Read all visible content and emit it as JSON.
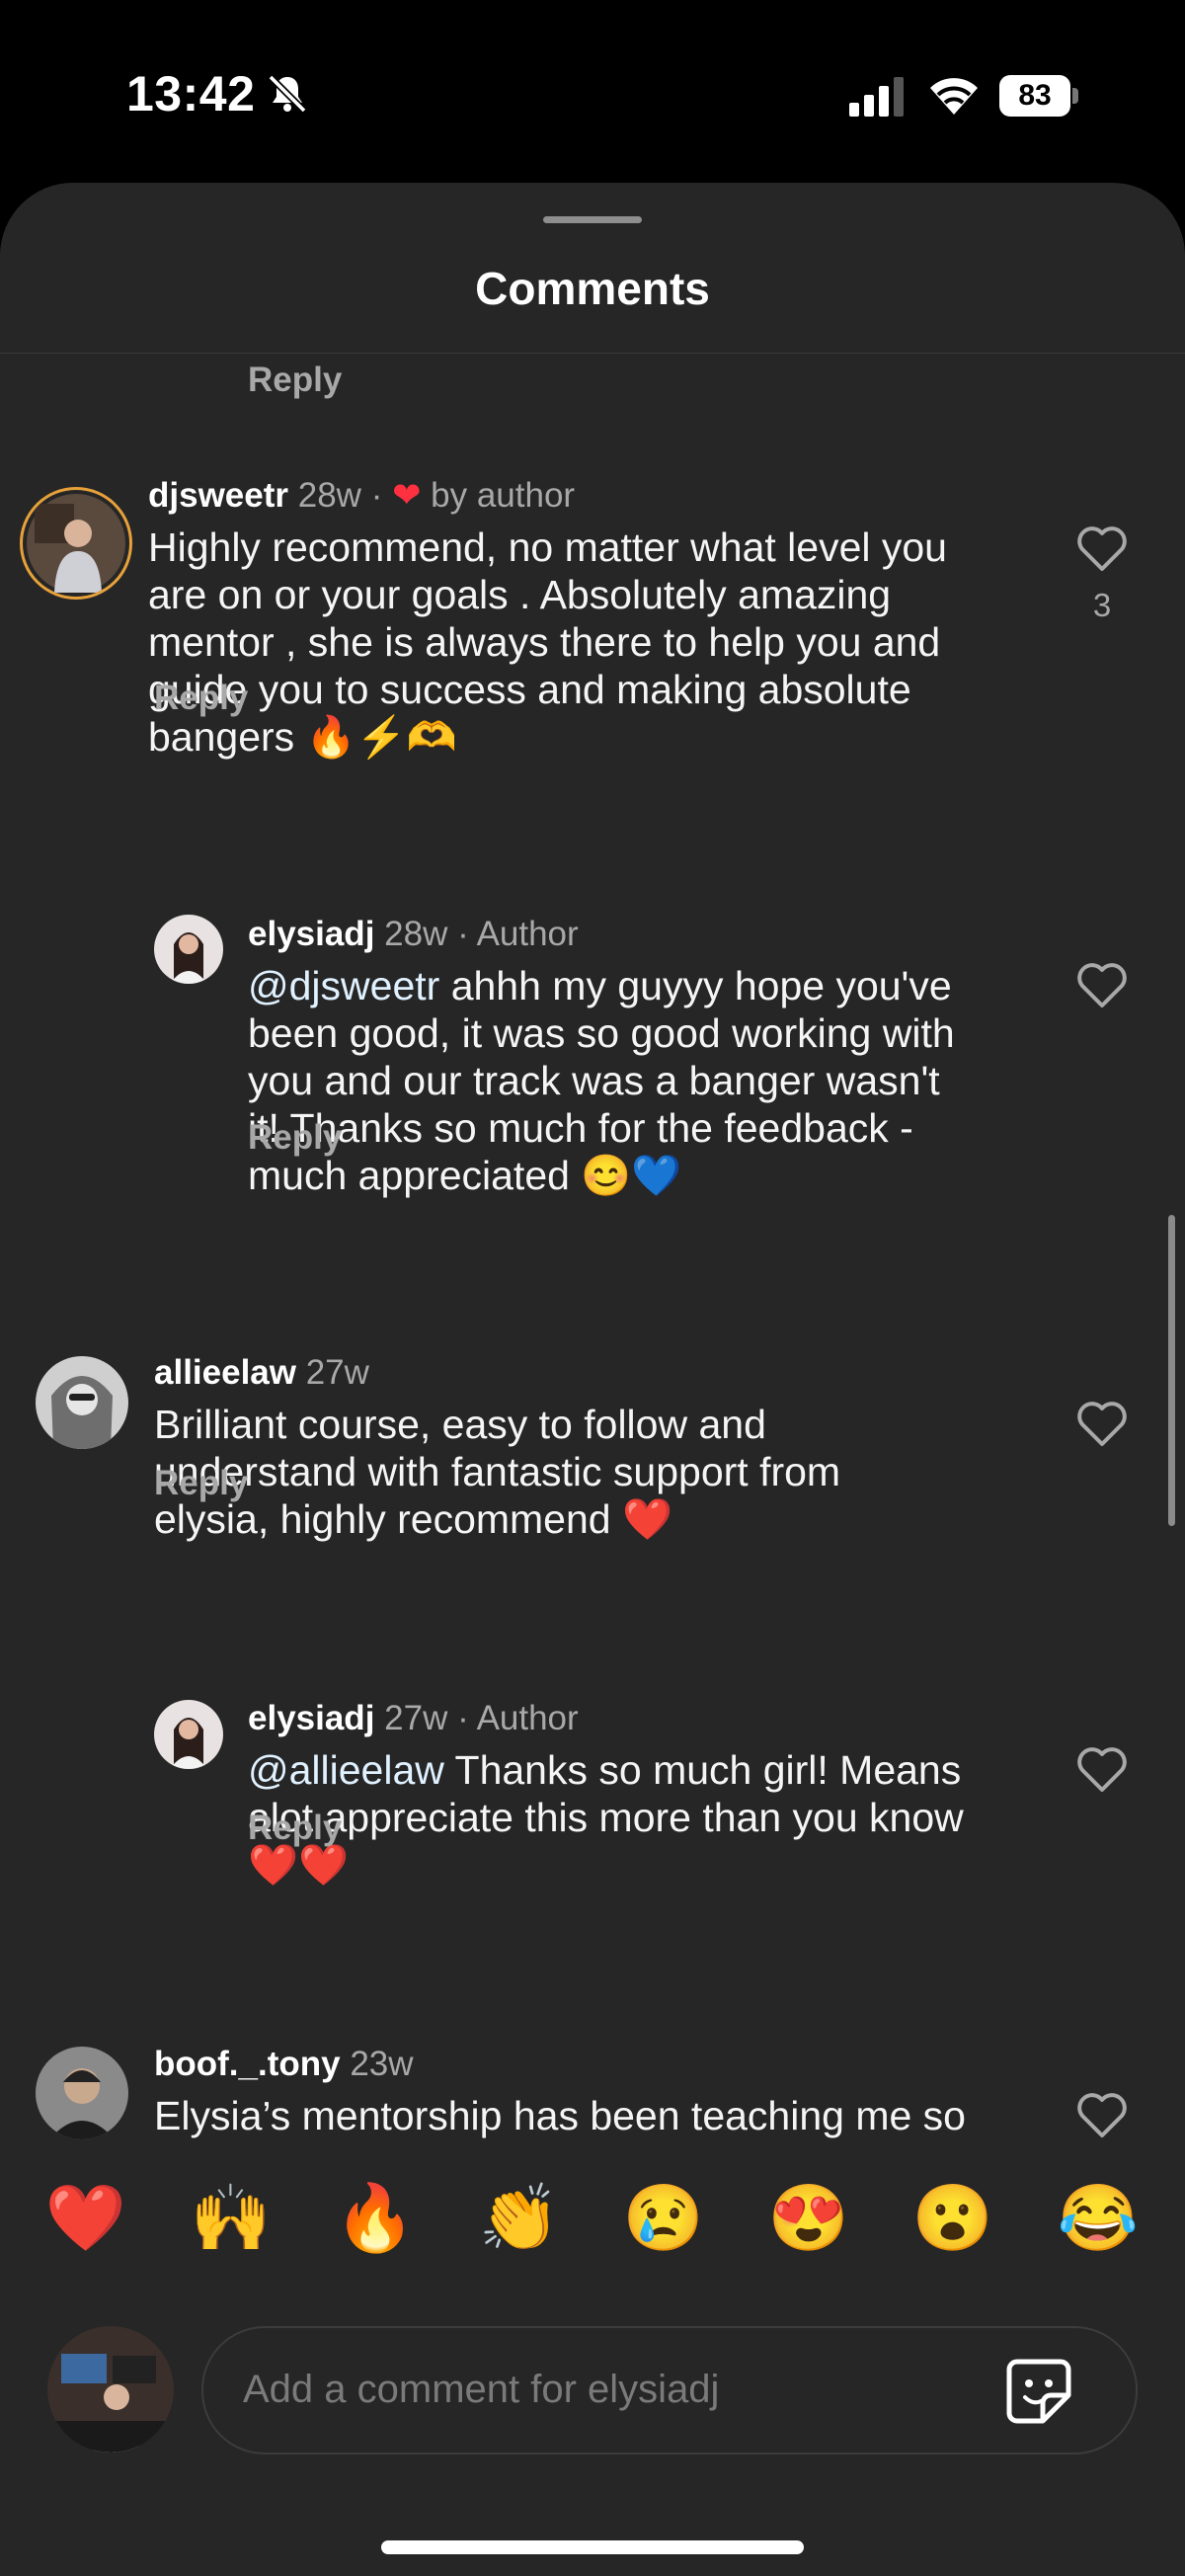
{
  "status_bar": {
    "time": "13:42",
    "battery": "83"
  },
  "sheet": {
    "title": "Comments",
    "top_reply_label": "Reply"
  },
  "comments": [
    {
      "username": "djsweetr",
      "time": "28w",
      "badge": "by author",
      "separator": "·",
      "lines": [
        "Highly recommend, no matter what level you",
        "are on or your goals . Absolutely amazing",
        "mentor , she is always there to help you and",
        "guide you to success and making absolute",
        "bangers 🔥⚡🫶"
      ],
      "likes": "3",
      "reply_label": "Reply"
    },
    {
      "username": "elysiadj",
      "time": "28w",
      "separator": "·",
      "tag": "Author",
      "mention": "@djsweetr",
      "lines": [
        "ahhh my guyyy hope you've",
        "been good, it was so good working with",
        "you and our track was a banger wasn't",
        "it! Thanks so much for the feedback -",
        "much appreciated 😊💙"
      ],
      "reply_label": "Reply"
    },
    {
      "username": "allieelaw",
      "time": "27w",
      "lines": [
        "Brilliant course, easy to follow and",
        "understand with fantastic support from",
        "elysia, highly recommend ❤️"
      ],
      "reply_label": "Reply"
    },
    {
      "username": "elysiadj",
      "time": "27w",
      "separator": "·",
      "tag": "Author",
      "mention": "@allieelaw",
      "lines": [
        "Thanks so much girl! Means",
        "alot appreciate this more than you know",
        "❤️❤️"
      ],
      "reply_label": "Reply"
    },
    {
      "username": "boof._.tony",
      "time": "23w",
      "lines": [
        "Elysia’s mentorship has been teaching me so"
      ]
    }
  ],
  "reactions": [
    "❤️",
    "🙌",
    "🔥",
    "👏",
    "😢",
    "😍",
    "😮",
    "😂"
  ],
  "composer": {
    "placeholder": "Add a comment for elysiadj"
  },
  "colors": {
    "sheet_bg": "#262626",
    "like_red": "#ff3040",
    "secondary_text": "#a8a8a8"
  },
  "icons": [
    "bell-slash-icon",
    "signal-icon",
    "wifi-icon",
    "heart-icon",
    "sticker-icon"
  ]
}
